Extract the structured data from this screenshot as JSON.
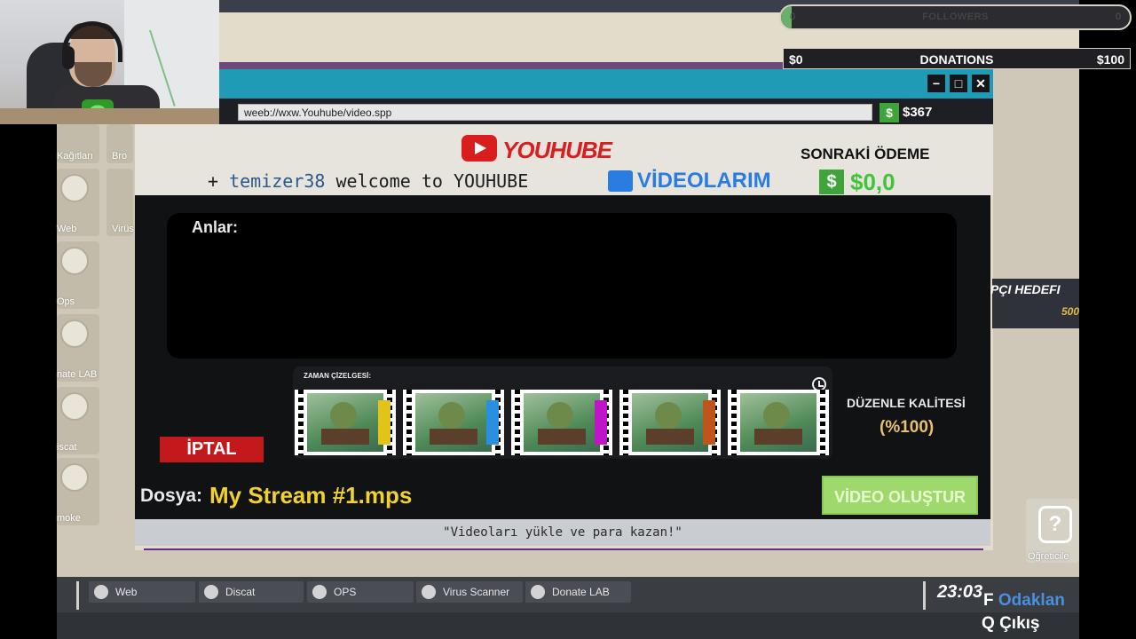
{
  "stream_overlay": {
    "followers_label": "FOLLOWERS",
    "followers_min": "0",
    "followers_max": "0",
    "followers_progress": 0.03,
    "donations_label": "DONATIONS",
    "donations_current": "$0",
    "donations_goal": "$100",
    "goal_label": "PÇI HEDEFI",
    "goal_value": "500"
  },
  "desktop_icons": [
    {
      "label": "Kağıtları",
      "icon": "paper-icon"
    },
    {
      "label": "Web",
      "icon": "globe-icon"
    },
    {
      "label": "Ops",
      "icon": "ops-icon"
    },
    {
      "label": "nate LAB",
      "icon": "flask-icon"
    },
    {
      "label": "iscat",
      "icon": "cat-icon"
    },
    {
      "label": "moke",
      "icon": "smoke-icon"
    }
  ],
  "desktop_icons_col2": [
    {
      "label": "Bro"
    },
    {
      "label": "Virüs"
    }
  ],
  "window": {
    "url": "weeb://wxw.Youhube/video.spp",
    "wallet_symbol": "$",
    "wallet": "$367"
  },
  "site": {
    "brand": "YOUHUBE",
    "welcome_prefix": "+ ",
    "username": "temizer38",
    "welcome_suffix": " welcome to YOUHUBE",
    "my_videos": "VİDEOLARIM",
    "next_payment_label": "SONRAKİ ÖDEME",
    "payment_symbol": "$",
    "next_payment_amount": "$0,0"
  },
  "editor": {
    "moments_label": "Anlar:",
    "timeline_label": "ZAMAN ÇİZELGESİ:",
    "clips": 5,
    "separator_colors": [
      "#e3c21a",
      "#2a8fe0",
      "#c014c9",
      "#c0541a"
    ],
    "quality_label": "DÜZENLE KALİTESİ",
    "quality_value": "(%100)",
    "cancel_label": "İPTAL",
    "file_label": "Dosya:",
    "file_name": "My Stream #1.mps",
    "create_label": "VİDEO OLUŞTUR",
    "footer_text": "\"Videoları yükle ve para kazan!\""
  },
  "help": {
    "label": "Öğreticile"
  },
  "taskbar": {
    "items": [
      {
        "label": "Web",
        "icon": "globe-icon"
      },
      {
        "label": "Discat",
        "icon": "cat-icon"
      },
      {
        "label": "OPS",
        "icon": "ops-icon"
      },
      {
        "label": "Virus Scanner",
        "icon": "bug-icon"
      },
      {
        "label": "Donate LAB",
        "icon": "flask-icon"
      }
    ],
    "clock": "23:03",
    "focus_key": "F",
    "focus_label": "Odaklan",
    "exit_key": "Q",
    "exit_label": "Çıkış"
  }
}
